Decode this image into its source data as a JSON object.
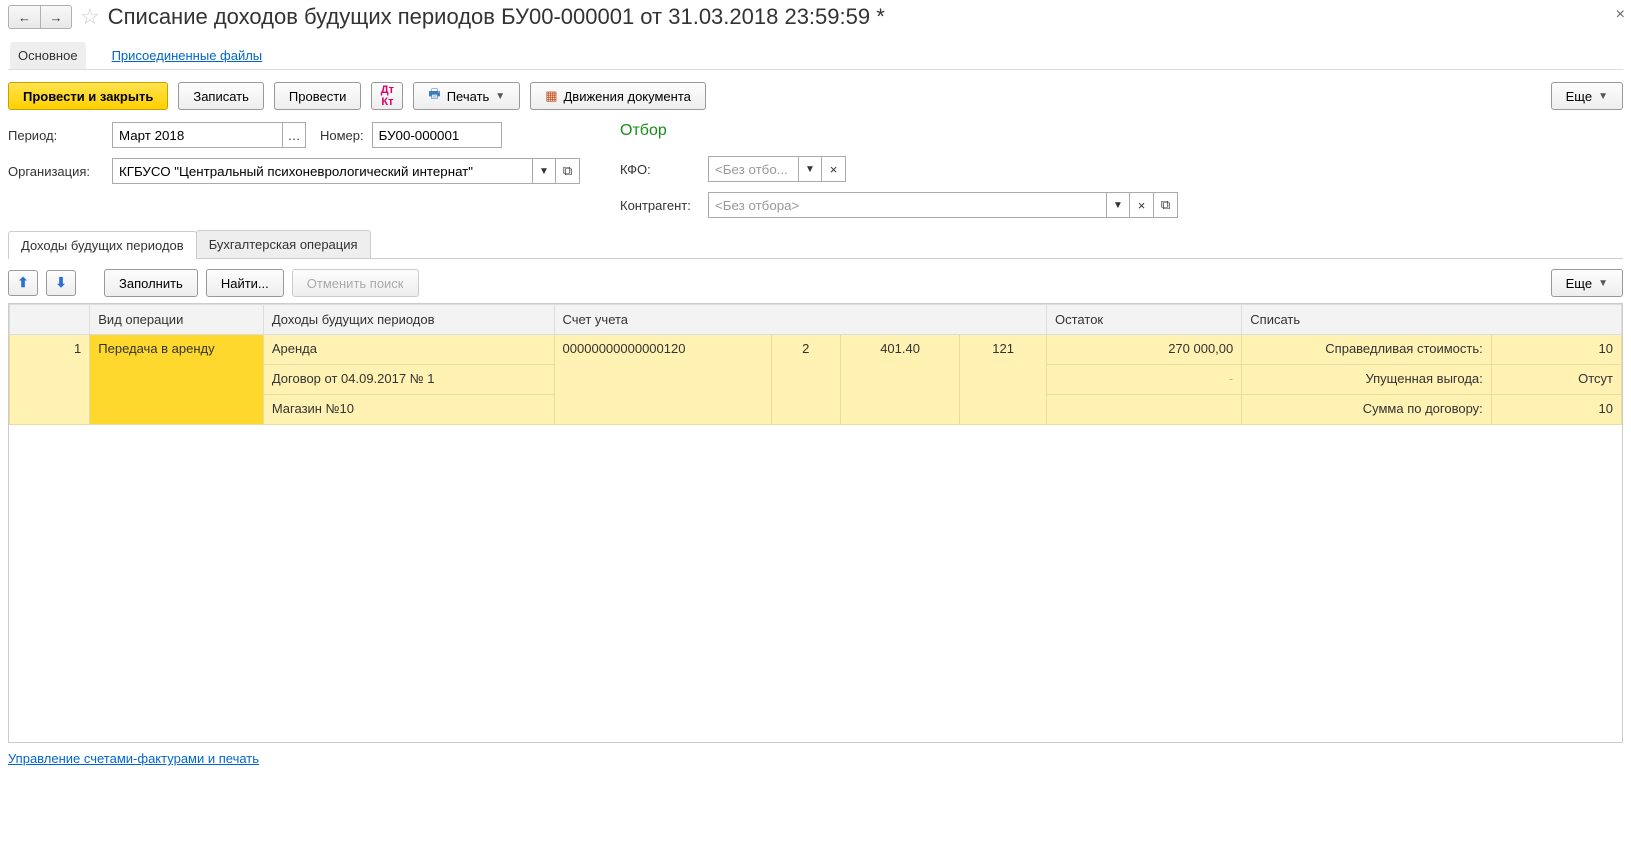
{
  "title": "Списание доходов будущих периодов БУ00-000001 от 31.03.2018 23:59:59 *",
  "topTabs": {
    "main": "Основное",
    "files": "Присоединенные файлы"
  },
  "toolbar": {
    "post_close": "Провести и закрыть",
    "save": "Записать",
    "post": "Провести",
    "print": "Печать",
    "movements": "Движения документа",
    "more": "Еще"
  },
  "form": {
    "period_label": "Период:",
    "period_value": "Март 2018",
    "number_label": "Номер:",
    "number_value": "БУ00-000001",
    "org_label": "Организация:",
    "org_value": "КГБУСО \"Центральный психоневрологический интернат\""
  },
  "filter": {
    "title": "Отбор",
    "kfo_label": "КФО:",
    "kfo_placeholder": "<Без отбо...",
    "contr_label": "Контрагент:",
    "contr_placeholder": "<Без отбора>"
  },
  "midTabs": {
    "income": "Доходы будущих периодов",
    "accounting": "Бухгалтерская операция"
  },
  "tableToolbar": {
    "fill": "Заполнить",
    "find": "Найти...",
    "cancel_find": "Отменить поиск",
    "more": "Еще"
  },
  "grid": {
    "headers": {
      "num": "",
      "op_type": "Вид операции",
      "income": "Доходы будущих периодов",
      "account": "Счет учета",
      "balance": "Остаток",
      "writeoff": "Списать"
    },
    "row": {
      "num": "1",
      "op_type": "Передача в аренду",
      "income1": "Аренда",
      "income2": "Договор от 04.09.2017 № 1",
      "income3": "Магазин №10",
      "acct_full": "00000000000000120",
      "acct_c2": "2",
      "acct_c3": "401.40",
      "acct_c4": "121",
      "balance": "270 000,00",
      "wo1_label": "Справедливая стоимость:",
      "wo1_val": "10",
      "wo2_label": "Упущенная выгода:",
      "wo2_val": "Отсут",
      "wo3_label": "Сумма по договору:",
      "wo3_val": "10"
    }
  },
  "footer_link": "Управление счетами-фактурами и печать"
}
